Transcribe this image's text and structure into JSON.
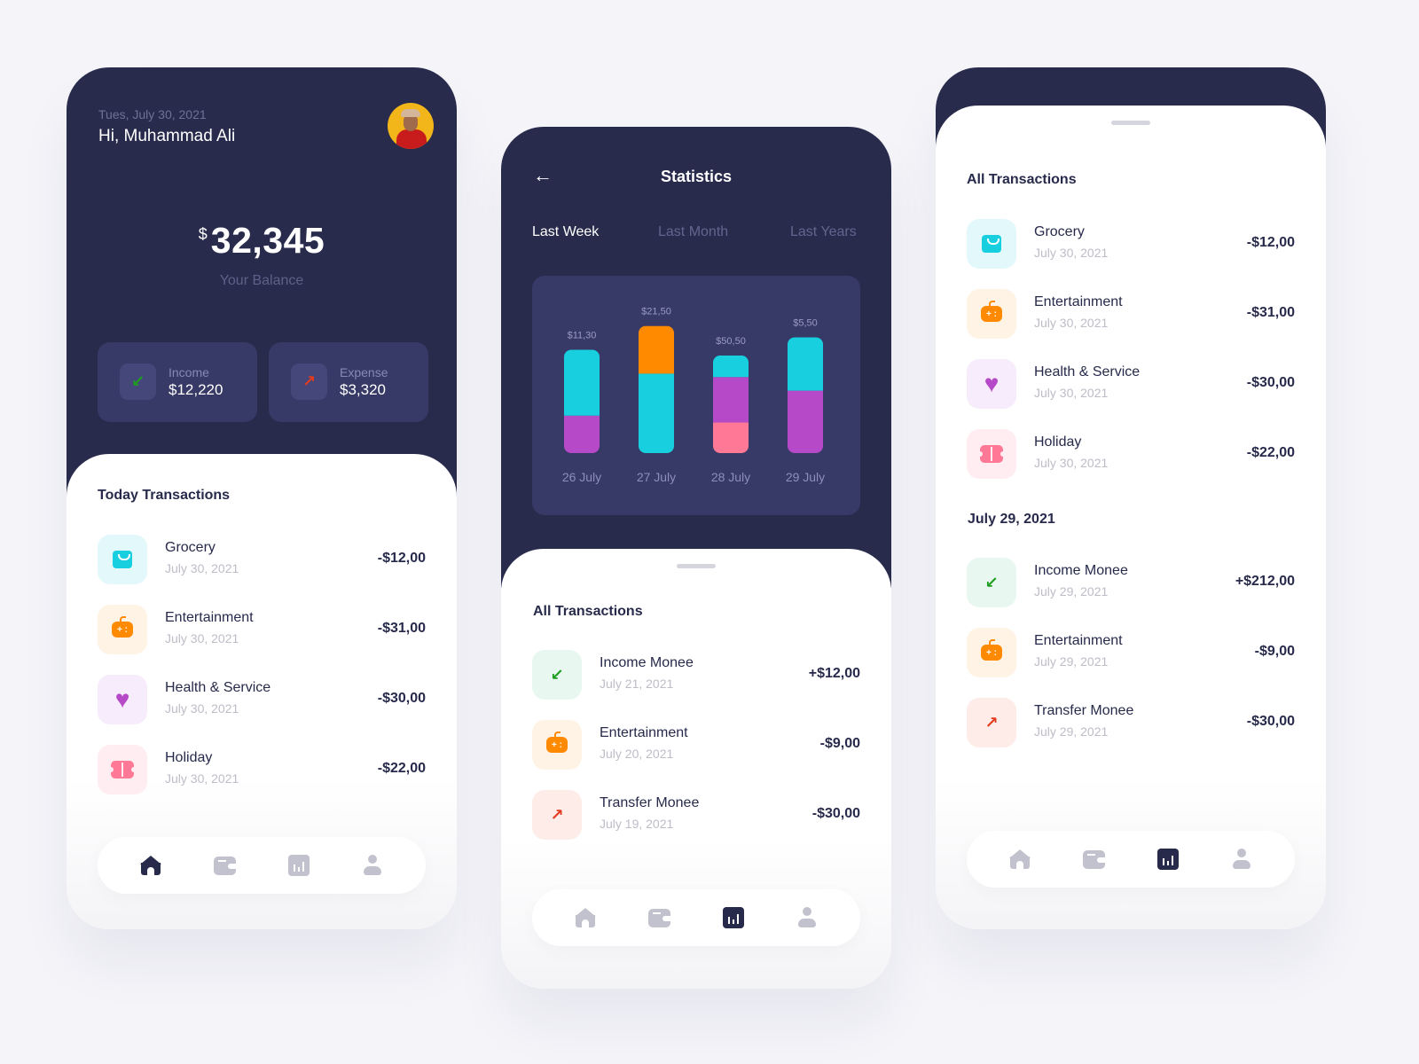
{
  "colors": {
    "navy": "#292b4c",
    "card": "#373966",
    "cyan": "#17cfdf",
    "orange": "#ff8a00",
    "purple": "#b649c8",
    "pink": "#ff7996",
    "income_green": "#1e9e1e",
    "expense_red": "#e33b1d"
  },
  "home": {
    "date": "Tues, July 30, 2021",
    "greeting": "Hi, Muhammad Ali",
    "avatar": "user-avatar",
    "balance_currency": "$",
    "balance": "32,345",
    "balance_label": "Your Balance",
    "income": {
      "label": "Income",
      "value": "$12,220",
      "icon": "arrow-down-left-icon"
    },
    "expense": {
      "label": "Expense",
      "value": "$3,320",
      "icon": "arrow-up-right-icon"
    },
    "section_title": "Today Transactions",
    "transactions": [
      {
        "name": "Grocery",
        "date": "July 30, 2021",
        "amount": "-$12,00",
        "icon": "shopping-bag-icon"
      },
      {
        "name": "Entertainment",
        "date": "July 30, 2021",
        "amount": "-$31,00",
        "icon": "gamepad-icon"
      },
      {
        "name": "Health & Service",
        "date": "July 30, 2021",
        "amount": "-$30,00",
        "icon": "heart-icon"
      },
      {
        "name": "Holiday",
        "date": "July 30, 2021",
        "amount": "-$22,00",
        "icon": "ticket-icon"
      }
    ]
  },
  "nav": {
    "items": [
      {
        "name": "home",
        "icon": "home-icon"
      },
      {
        "name": "wallet",
        "icon": "wallet-icon"
      },
      {
        "name": "statistics",
        "icon": "chart-icon"
      },
      {
        "name": "profile",
        "icon": "user-icon"
      }
    ]
  },
  "stats": {
    "back_icon": "←",
    "title": "Statistics",
    "tabs": [
      {
        "label": "Last Week",
        "active": true
      },
      {
        "label": "Last Month",
        "active": false
      },
      {
        "label": "Last Years",
        "active": false
      }
    ],
    "section_title": "All Transactions",
    "transactions": [
      {
        "name": "Income Monee",
        "date": "July 21, 2021",
        "amount": "+$12,00",
        "icon": "arrow-down-left-icon"
      },
      {
        "name": "Entertainment",
        "date": "July 20, 2021",
        "amount": "-$9,00",
        "icon": "gamepad-icon"
      },
      {
        "name": "Transfer Monee",
        "date": "July 19, 2021",
        "amount": "-$30,00",
        "icon": "arrow-up-right-icon"
      }
    ]
  },
  "chart_data": {
    "type": "bar",
    "stacked": true,
    "title": "",
    "xlabel": "",
    "ylabel": "",
    "categories": [
      "26 July",
      "27 July",
      "28 July",
      "29 July"
    ],
    "labels": [
      "$11,30",
      "$21,50",
      "$50,50",
      "$5,50"
    ],
    "series": [
      {
        "name": "purple",
        "color": "#b649c8",
        "values": [
          33,
          0,
          40,
          55
        ]
      },
      {
        "name": "pink",
        "color": "#ff7996",
        "values": [
          0,
          0,
          27,
          0
        ]
      },
      {
        "name": "cyan",
        "color": "#17cfdf",
        "values": [
          58,
          70,
          19,
          47
        ]
      },
      {
        "name": "orange",
        "color": "#ff8a00",
        "values": [
          0,
          42,
          0,
          0
        ]
      }
    ],
    "series_order_note": "bottom to top: 26 July purple+cyan; 27 July cyan+orange; 28 July pink+purple+cyan; 29 July purple+cyan",
    "stack_order": [
      [
        "purple",
        "cyan"
      ],
      [
        "cyan",
        "orange"
      ],
      [
        "pink",
        "purple",
        "cyan"
      ],
      [
        "purple",
        "cyan"
      ]
    ],
    "grid": false,
    "legend": "none"
  },
  "all": {
    "section_title": "All Transactions",
    "transactions": [
      {
        "name": "Grocery",
        "date": "July 30, 2021",
        "amount": "-$12,00",
        "icon": "shopping-bag-icon"
      },
      {
        "name": "Entertainment",
        "date": "July 30, 2021",
        "amount": "-$31,00",
        "icon": "gamepad-icon"
      },
      {
        "name": "Health & Service",
        "date": "July 30, 2021",
        "amount": "-$30,00",
        "icon": "heart-icon"
      },
      {
        "name": "Holiday",
        "date": "July 30, 2021",
        "amount": "-$22,00",
        "icon": "ticket-icon"
      }
    ],
    "group2_title": "July 29, 2021",
    "group2": [
      {
        "name": "Income Monee",
        "date": "July 29, 2021",
        "amount": "+$212,00",
        "icon": "arrow-down-left-icon"
      },
      {
        "name": "Entertainment",
        "date": "July 29, 2021",
        "amount": "-$9,00",
        "icon": "gamepad-icon"
      },
      {
        "name": "Transfer Monee",
        "date": "July 29, 2021",
        "amount": "-$30,00",
        "icon": "arrow-up-right-icon"
      }
    ]
  }
}
